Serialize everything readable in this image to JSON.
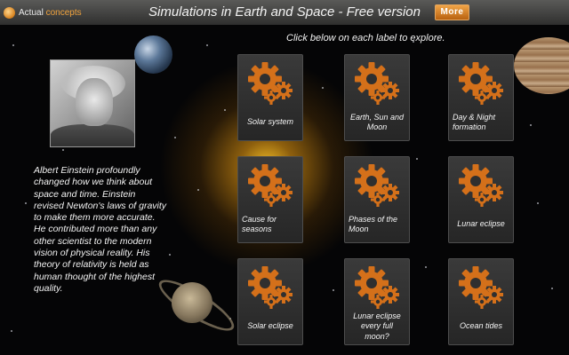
{
  "header": {
    "logo_prefix": "Actual",
    "logo_accent": "concepts",
    "title": "Simulations in Earth and Space - Free version",
    "more_label": "More"
  },
  "instruction": "Click below on each label to explore.",
  "description": "Albert Einstein profoundly changed how we think about space and time. Einstein revised Newton's laws of gravity to make them more accurate. He contributed more than any other scientist to the modern vision of physical reality. His theory of relativity is held as human thought of the highest quality.",
  "tiles": [
    {
      "label": "Solar system",
      "icon": "gears-icon"
    },
    {
      "label": "Earth, Sun and Moon",
      "icon": "gears-icon"
    },
    {
      "label": "Day & Night formation",
      "icon": "gears-icon"
    },
    {
      "label": "Cause for seasons",
      "icon": "gears-icon"
    },
    {
      "label": "Phases of the Moon",
      "icon": "gears-icon"
    },
    {
      "label": "Lunar eclipse",
      "icon": "gears-icon"
    },
    {
      "label": "Solar eclipse",
      "icon": "gears-icon"
    },
    {
      "label": "Lunar eclipse every full moon?",
      "icon": "gears-icon"
    },
    {
      "label": "Ocean tides",
      "icon": "gears-icon"
    }
  ],
  "colors": {
    "accent": "#d9731c",
    "tile_bg": "#2f2f2f",
    "more_button": "#d98a2e"
  }
}
